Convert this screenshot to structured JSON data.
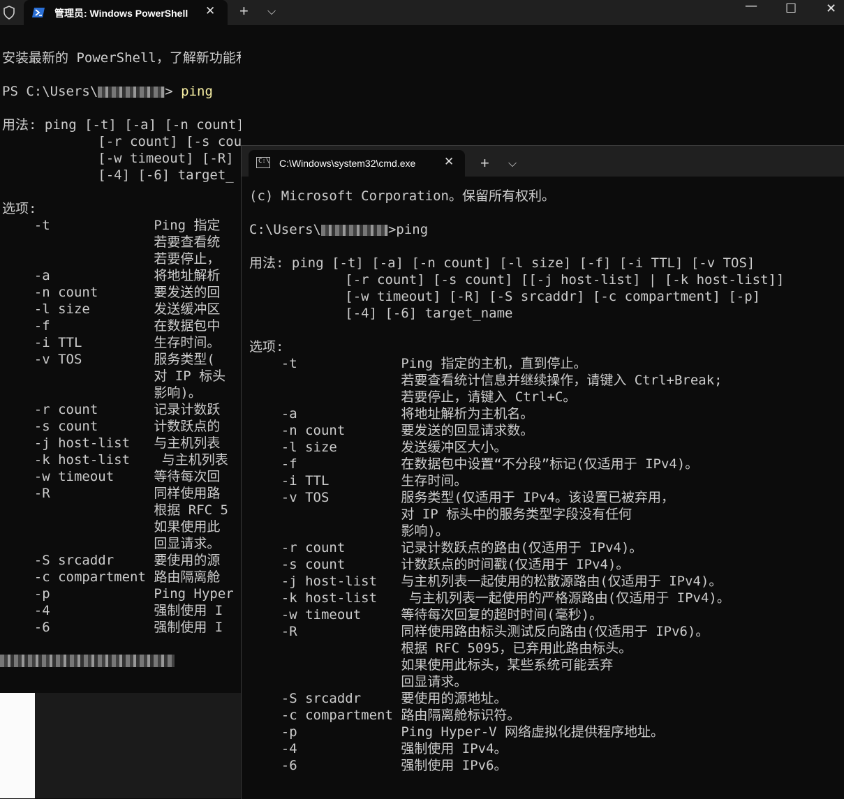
{
  "powershell": {
    "tab_title": "管理员: Windows PowerShell",
    "close_glyph": "✕",
    "new_tab_glyph": "+",
    "dropdown_glyph": "⌵",
    "minimize_glyph": "—",
    "maximize_glyph": "☐",
    "window_close_glyph": "✕",
    "lines": [
      "安装最新的 PowerShell，了解新功能和改进！https://aka.ms/PSWindows",
      "",
      "__PROMPT__",
      "",
      "用法: ping [-t] [-a] [-n count] [-l size] [-f] [-i TTL] [-v TOS]",
      "            [-r count] [-s count] [[-j host-list] | [-k host-list]]",
      "            [-w timeout] [-R]",
      "            [-4] [-6] target_",
      "",
      "选项:",
      "    -t             Ping 指定",
      "                   若要查看统",
      "                   若要停止，",
      "    -a             将地址解析",
      "    -n count       要发送的回",
      "    -l size        发送缓冲区",
      "    -f             在数据包中",
      "    -i TTL         生存时间。",
      "    -v TOS         服务类型(",
      "                   对 IP 标头",
      "                   影响)。",
      "    -r count       记录计数跃",
      "    -s count       计数跃点的",
      "    -j host-list   与主机列表",
      "    -k host-list    与主机列表",
      "    -w timeout     等待每次回",
      "    -R             同样使用路",
      "                   根据 RFC 5",
      "                   如果使用此",
      "                   回显请求。",
      "    -S srcaddr     要使用的源",
      "    -c compartment 路由隔离舱",
      "    -p             Ping Hyper",
      "    -4             强制使用 I",
      "    -6             强制使用 I"
    ],
    "prompt": {
      "prefix": "PS C:\\Users\\",
      "suffix": "> ",
      "command": "ping"
    }
  },
  "cmd": {
    "tab_title": "C:\\Windows\\system32\\cmd.exe",
    "close_glyph": "✕",
    "new_tab_glyph": "+",
    "dropdown_glyph": "⌵",
    "icon_text": "C:\\",
    "lines": [
      "(c) Microsoft Corporation。保留所有权利。",
      "",
      "__PROMPT__",
      "",
      "用法: ping [-t] [-a] [-n count] [-l size] [-f] [-i TTL] [-v TOS]",
      "            [-r count] [-s count] [[-j host-list] | [-k host-list]]",
      "            [-w timeout] [-R] [-S srcaddr] [-c compartment] [-p]",
      "            [-4] [-6] target_name",
      "",
      "选项:",
      "    -t             Ping 指定的主机，直到停止。",
      "                   若要查看统计信息并继续操作，请键入 Ctrl+Break;",
      "                   若要停止，请键入 Ctrl+C。",
      "    -a             将地址解析为主机名。",
      "    -n count       要发送的回显请求数。",
      "    -l size        发送缓冲区大小。",
      "    -f             在数据包中设置“不分段”标记(仅适用于 IPv4)。",
      "    -i TTL         生存时间。",
      "    -v TOS         服务类型(仅适用于 IPv4。该设置已被弃用，",
      "                   对 IP 标头中的服务类型字段没有任何",
      "                   影响)。",
      "    -r count       记录计数跃点的路由(仅适用于 IPv4)。",
      "    -s count       计数跃点的时间戳(仅适用于 IPv4)。",
      "    -j host-list   与主机列表一起使用的松散源路由(仅适用于 IPv4)。",
      "    -k host-list    与主机列表一起使用的严格源路由(仅适用于 IPv4)。",
      "    -w timeout     等待每次回复的超时时间(毫秒)。",
      "    -R             同样使用路由标头测试反向路由(仅适用于 IPv6)。",
      "                   根据 RFC 5095，已弃用此路由标头。",
      "                   如果使用此标头，某些系统可能丢弃",
      "                   回显请求。",
      "    -S srcaddr     要使用的源地址。",
      "    -c compartment 路由隔离舱标识符。",
      "    -p             Ping Hyper-V 网络虚拟化提供程序地址。",
      "    -4             强制使用 IPv4。",
      "    -6             强制使用 IPv6。"
    ],
    "prompt": {
      "prefix": "C:\\Users\\",
      "suffix": ">",
      "command": "ping"
    }
  }
}
